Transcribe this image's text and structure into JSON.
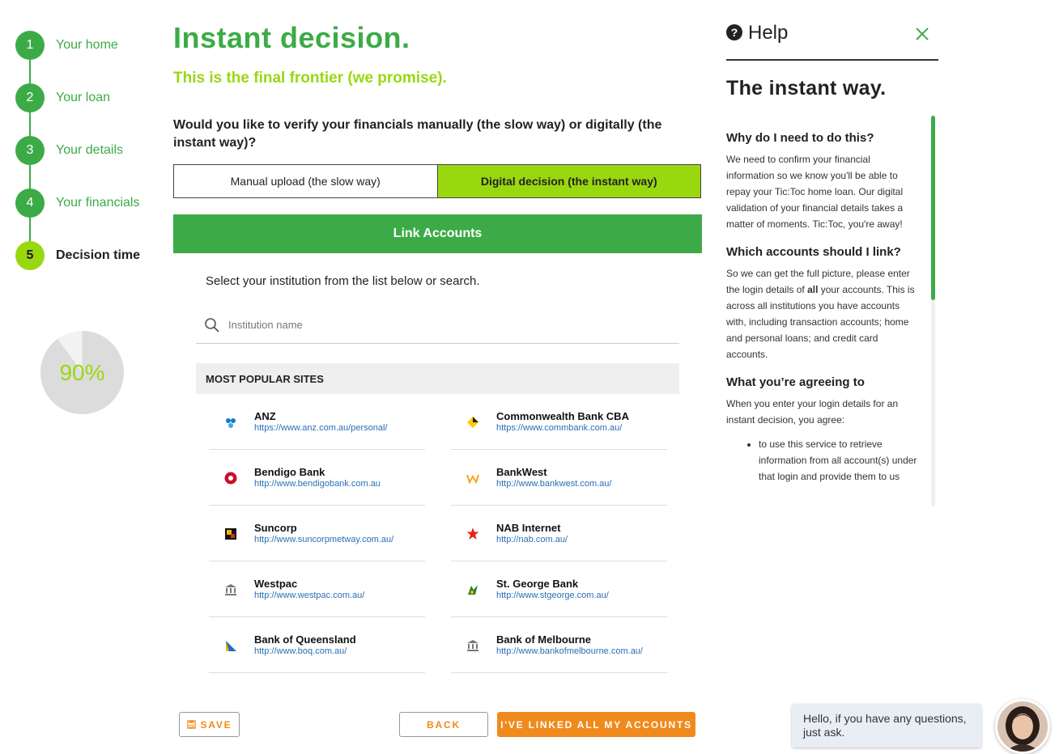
{
  "stepper": {
    "steps": [
      {
        "num": "1",
        "label": "Your home"
      },
      {
        "num": "2",
        "label": "Your loan"
      },
      {
        "num": "3",
        "label": "Your details"
      },
      {
        "num": "4",
        "label": "Your financials"
      },
      {
        "num": "5",
        "label": "Decision time"
      }
    ],
    "active_step": 5,
    "progress_label": "90%",
    "progress_value": 0.9
  },
  "main": {
    "title": "Instant decision.",
    "subtitle": "This is the final frontier (we promise).",
    "question": "Would you like to verify your financials manually (the slow way) or digitally (the instant way)?",
    "options": [
      {
        "label": "Manual upload (the slow way)",
        "selected": false
      },
      {
        "label": "Digital decision (the instant way)",
        "selected": true
      }
    ],
    "link_accounts": "Link Accounts",
    "select_text": "Select your institution from the list below or search.",
    "search_placeholder": "Institution name",
    "popular_header": "MOST POPULAR SITES",
    "banks": [
      {
        "name": "ANZ",
        "url": "https://www.anz.com.au/personal/",
        "icon": "anz-logo-icon"
      },
      {
        "name": "Commonwealth Bank CBA",
        "url": "https://www.commbank.com.au/",
        "icon": "commbank-logo-icon"
      },
      {
        "name": "Bendigo Bank",
        "url": "http://www.bendigobank.com.au",
        "icon": "bendigo-logo-icon"
      },
      {
        "name": "BankWest",
        "url": "http://www.bankwest.com.au/",
        "icon": "bankwest-logo-icon"
      },
      {
        "name": "Suncorp",
        "url": "http://www.suncorpmetway.com.au/",
        "icon": "suncorp-logo-icon"
      },
      {
        "name": "NAB Internet",
        "url": "http://nab.com.au/",
        "icon": "nab-logo-icon"
      },
      {
        "name": "Westpac",
        "url": "http://www.westpac.com.au/",
        "icon": "bank-building-icon"
      },
      {
        "name": "St. George Bank",
        "url": "http://www.stgeorge.com.au/",
        "icon": "stgeorge-logo-icon"
      },
      {
        "name": "Bank of Queensland",
        "url": "http://www.boq.com.au/",
        "icon": "boq-logo-icon"
      },
      {
        "name": "Bank of Melbourne",
        "url": "http://www.bankofmelbourne.com.au/",
        "icon": "bank-building-icon"
      }
    ]
  },
  "footer": {
    "save_label": "SAVE",
    "back_label": "BACK",
    "linked_label": "I'VE LINKED ALL MY ACCOUNTS"
  },
  "help": {
    "header": "Help",
    "title": "The instant way.",
    "section1_title": "Why do I need to do this?",
    "section1_text": "We need to confirm your financial information so we know you'll be able to repay your Tic:Toc home loan. Our digital validation of your financial details takes a matter of moments. Tic:Toc, you're away!",
    "section2_title": "Which accounts should I link?",
    "section2_text_a": "So we can get the full picture, please enter the login details of ",
    "section2_text_bold": "all",
    "section2_text_b": " your accounts. This is across all institutions you have accounts with, including transaction accounts; home and personal loans; and credit card accounts.",
    "section3_title": "What you’re agreeing to",
    "section3_text": "When you enter your login details for an instant decision, you agree:",
    "section3_bullet": "to use this service to retrieve information from all account(s) under that login and provide them to us"
  },
  "chat": {
    "message": "Hello, if you have any questions, just ask."
  },
  "colors": {
    "brand_green": "#3cab47",
    "lime": "#99d80f",
    "orange": "#f08a1d",
    "link_blue": "#2a6fb5"
  }
}
